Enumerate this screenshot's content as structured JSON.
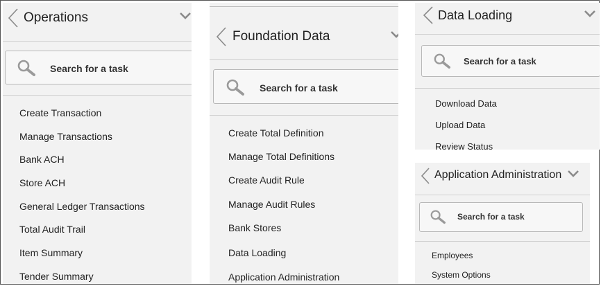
{
  "panels": [
    {
      "title": "Operations",
      "search_placeholder": "Search for a task",
      "items": [
        "Create Transaction",
        "Manage Transactions",
        "Bank ACH",
        "Store ACH",
        "General Ledger Transactions",
        "Total Audit Trail",
        "Item Summary",
        "Tender Summary"
      ]
    },
    {
      "title": "Foundation Data",
      "search_placeholder": "Search for a task",
      "items": [
        "Create Total Definition",
        "Manage Total Definitions",
        "Create Audit Rule",
        "Manage Audit Rules",
        "Bank Stores",
        "Data Loading",
        "Application Administration"
      ]
    },
    {
      "title": "Data Loading",
      "search_placeholder": "Search for a task",
      "items": [
        "Download Data",
        "Upload Data",
        "Review Status"
      ]
    },
    {
      "title": "Application Administration",
      "search_placeholder": "Search for a task",
      "items": [
        "Employees",
        "System Options"
      ]
    }
  ],
  "colors": {
    "panel_bg": "#f2f2f2",
    "text": "#222222",
    "chevron": "#8a8a8a",
    "search_icon": "#9a9a9a"
  },
  "icons": {
    "back": "chevron-left-icon",
    "expand": "chevron-down-icon",
    "search": "search-icon"
  }
}
